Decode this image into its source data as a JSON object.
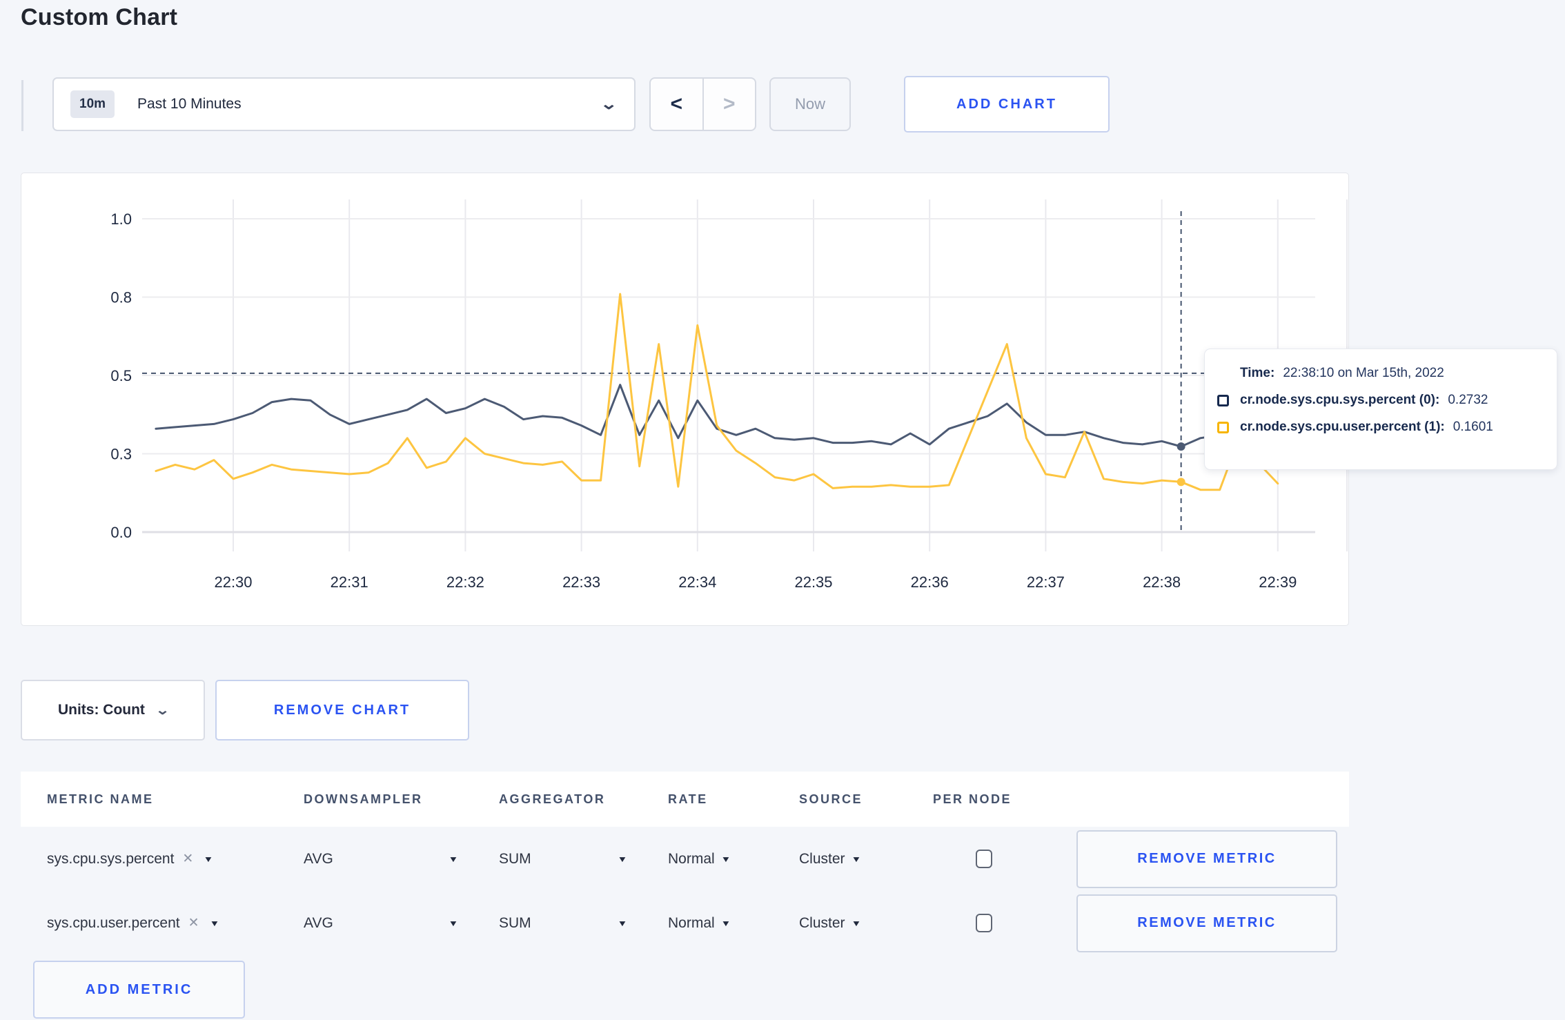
{
  "page": {
    "title": "Custom Chart"
  },
  "toolbar": {
    "time_badge": "10m",
    "time_label": "Past 10 Minutes",
    "chevron_down_icon": "⌄",
    "prev_icon": "<",
    "next_icon": ">",
    "now_label": "Now",
    "add_chart_label": "ADD CHART"
  },
  "chart_actions": {
    "units_label": "Units: Count",
    "units_chevron_icon": "⌄",
    "remove_chart_label": "REMOVE CHART"
  },
  "chart_data": {
    "type": "line",
    "title": "",
    "xlabel": "",
    "ylabel": "",
    "grid": true,
    "legend_position": "none",
    "ylim": [
      0,
      1
    ],
    "y_ticks": [
      {
        "label": "1.0",
        "value": 1.0
      },
      {
        "label": "0.8",
        "value": 0.75
      },
      {
        "label": "0.5",
        "value": 0.5
      },
      {
        "label": "0.3",
        "value": 0.25
      },
      {
        "label": "0.0",
        "value": 0.0
      }
    ],
    "x_ticks": [
      "22:30",
      "22:31",
      "22:32",
      "22:33",
      "22:34",
      "22:35",
      "22:36",
      "22:37",
      "22:38",
      "22:39"
    ],
    "start_offset_sec": -40,
    "interval_sec": 10,
    "series": [
      {
        "name": "cr.node.sys.cpu.sys.percent (0)",
        "color": "#4c5a74",
        "values": [
          0.33,
          0.335,
          0.34,
          0.345,
          0.36,
          0.38,
          0.415,
          0.425,
          0.42,
          0.375,
          0.345,
          0.36,
          0.375,
          0.39,
          0.425,
          0.38,
          0.395,
          0.425,
          0.4,
          0.36,
          0.37,
          0.365,
          0.34,
          0.31,
          0.47,
          0.31,
          0.42,
          0.3,
          0.42,
          0.33,
          0.31,
          0.33,
          0.3,
          0.295,
          0.3,
          0.285,
          0.285,
          0.29,
          0.28,
          0.315,
          0.28,
          0.33,
          0.35,
          0.37,
          0.41,
          0.35,
          0.31,
          0.31,
          0.32,
          0.3,
          0.285,
          0.28,
          0.29,
          0.2732,
          0.3,
          0.31,
          0.3,
          0.29,
          0.3
        ]
      },
      {
        "name": "cr.node.sys.cpu.user.percent (1)",
        "color": "#fdc541",
        "values": [
          0.195,
          0.215,
          0.2,
          0.23,
          0.17,
          0.19,
          0.215,
          0.2,
          0.195,
          0.19,
          0.185,
          0.19,
          0.22,
          0.3,
          0.205,
          0.225,
          0.3,
          0.25,
          0.235,
          0.22,
          0.215,
          0.225,
          0.165,
          0.165,
          0.76,
          0.21,
          0.6,
          0.145,
          0.66,
          0.34,
          0.26,
          0.22,
          0.175,
          0.165,
          0.185,
          0.14,
          0.145,
          0.145,
          0.15,
          0.145,
          0.145,
          0.15,
          0.3,
          0.45,
          0.6,
          0.3,
          0.185,
          0.175,
          0.32,
          0.17,
          0.16,
          0.155,
          0.165,
          0.1601,
          0.135,
          0.135,
          0.3,
          0.22,
          0.155
        ]
      }
    ],
    "crosshair": {
      "time_sec": 490,
      "y_value": 0.507
    },
    "tooltip": {
      "time_label": "Time:",
      "time_value": "22:38:10 on Mar 15th, 2022",
      "rows": [
        {
          "name": "cr.node.sys.cpu.sys.percent (0):",
          "value": "0.2732",
          "color": "#16294e"
        },
        {
          "name": "cr.node.sys.cpu.user.percent (1):",
          "value": "0.1601",
          "color": "#f7b500"
        }
      ]
    }
  },
  "table": {
    "columns": [
      "METRIC NAME",
      "DOWNSAMPLER",
      "AGGREGATOR",
      "RATE",
      "SOURCE",
      "PER NODE"
    ],
    "rows": [
      {
        "metric": "sys.cpu.sys.percent",
        "downsampler": "AVG",
        "aggregator": "SUM",
        "rate": "Normal",
        "source": "Cluster",
        "per_node_checked": false,
        "remove_label": "REMOVE METRIC"
      },
      {
        "metric": "sys.cpu.user.percent",
        "downsampler": "AVG",
        "aggregator": "SUM",
        "rate": "Normal",
        "source": "Cluster",
        "per_node_checked": false,
        "remove_label": "REMOVE METRIC"
      }
    ],
    "clear_icon": "✕",
    "caret_icon": "▼",
    "add_metric_label": "ADD METRIC"
  }
}
